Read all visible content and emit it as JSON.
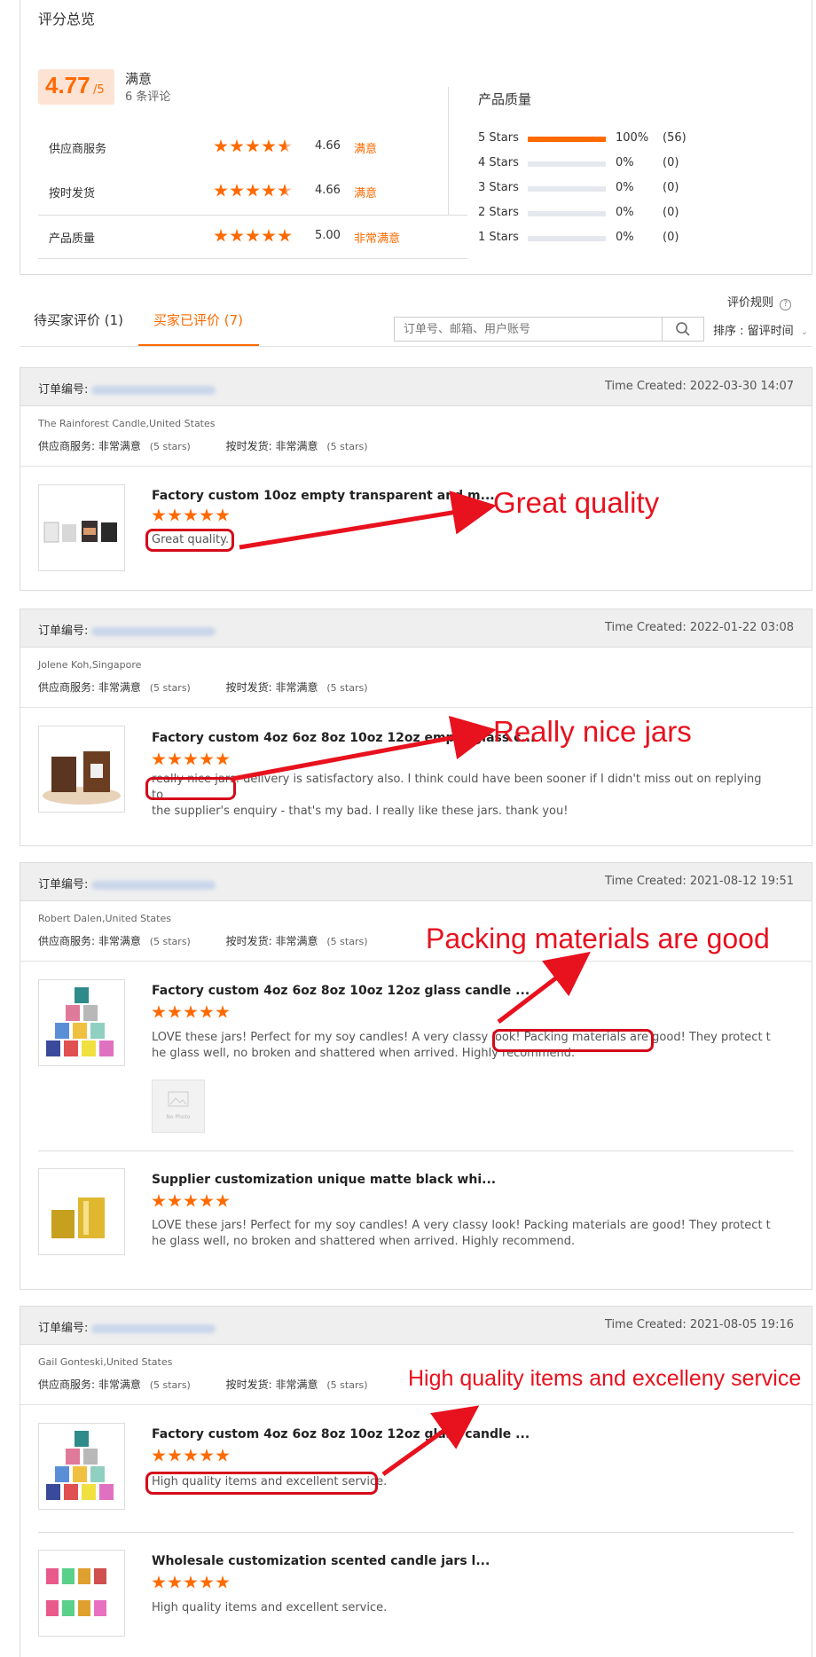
{
  "summary": {
    "title": "评分总览",
    "score": "4.77",
    "score_suffix": "/5",
    "verdict": "满意",
    "review_count": "6 条评论",
    "rows": [
      {
        "label": "供应商服务",
        "value": "4.66",
        "verdict": "满意",
        "stars": 4.66
      },
      {
        "label": "按时发货",
        "value": "4.66",
        "verdict": "满意",
        "stars": 4.66
      },
      {
        "label": "产品质量",
        "value": "5.00",
        "verdict": "非常满意",
        "stars": 5
      }
    ],
    "quality_title": "产品质量",
    "distribution": [
      {
        "label": "5 Stars",
        "pct": "100%",
        "count": "(56)",
        "fill": 1.0
      },
      {
        "label": "4 Stars",
        "pct": "0%",
        "count": "(0)",
        "fill": 0
      },
      {
        "label": "3 Stars",
        "pct": "0%",
        "count": "(0)",
        "fill": 0
      },
      {
        "label": "2 Stars",
        "pct": "0%",
        "count": "(0)",
        "fill": 0
      },
      {
        "label": "1 Stars",
        "pct": "0%",
        "count": "(0)",
        "fill": 0
      }
    ]
  },
  "rules_link": "评价规则",
  "tabs": [
    {
      "label": "待买家评价 (1)"
    },
    {
      "label": "买家已评价 (7)"
    }
  ],
  "search": {
    "placeholder": "订单号、邮箱、用户账号"
  },
  "sort_label": "排序 : 留评时间",
  "labels": {
    "order_no": "订单编号:",
    "supplier_service": "供应商服务:",
    "on_time": "按时发货:",
    "very_satisfied": "非常满意",
    "five_stars": "(5 stars)",
    "no_photo": "No Photo"
  },
  "orders": [
    {
      "time": "Time Created: 2022-03-30 14:07",
      "buyer": "The Rainforest Candle,United States",
      "items": [
        {
          "name": "Factory custom 10oz empty transparent and m...",
          "comment": "Great quality."
        }
      ],
      "annotation": "Great quality"
    },
    {
      "time": "Time Created: 2022-01-22 03:08",
      "buyer": "Jolene Koh,Singapore",
      "items": [
        {
          "name": "Factory custom 4oz 6oz 8oz 10oz 12oz empty glass c...",
          "comment_line1": "really nice jars. delivery is satisfactory also. I think could have been sooner if I didn't miss out on replying to",
          "comment_line2": "the supplier's enquiry - that's my bad. I really like these jars. thank you!"
        }
      ],
      "annotation": "Really nice jars"
    },
    {
      "time": "Time Created: 2021-08-12 19:51",
      "buyer": "Robert Dalen,United States",
      "items": [
        {
          "name": "Factory custom 4oz 6oz 8oz 10oz 12oz glass candle ...",
          "comment_line1": "LOVE these jars! Perfect for my soy candles! A very classy look! Packing materials are good! They protect t",
          "comment_line2": "he glass well, no broken and shattered when arrived. Highly recommend."
        },
        {
          "name": "Supplier customization unique matte black whi...",
          "comment_line1": "LOVE these jars! Perfect for my soy candles! A very classy look! Packing materials are good! They protect t",
          "comment_line2": "he glass well, no broken and shattered when arrived. Highly recommend."
        }
      ],
      "annotation": "Packing materials are good"
    },
    {
      "time": "Time Created: 2021-08-05 19:16",
      "buyer": "Gail Gonteski,United States",
      "items": [
        {
          "name": "Factory custom 4oz 6oz 8oz 10oz 12oz glass candle ...",
          "comment": "High quality items and excellent service."
        },
        {
          "name": "Wholesale customization scented candle jars l...",
          "comment": "High quality items and excellent service."
        }
      ],
      "annotation": "High quality items and excelleny service"
    }
  ]
}
